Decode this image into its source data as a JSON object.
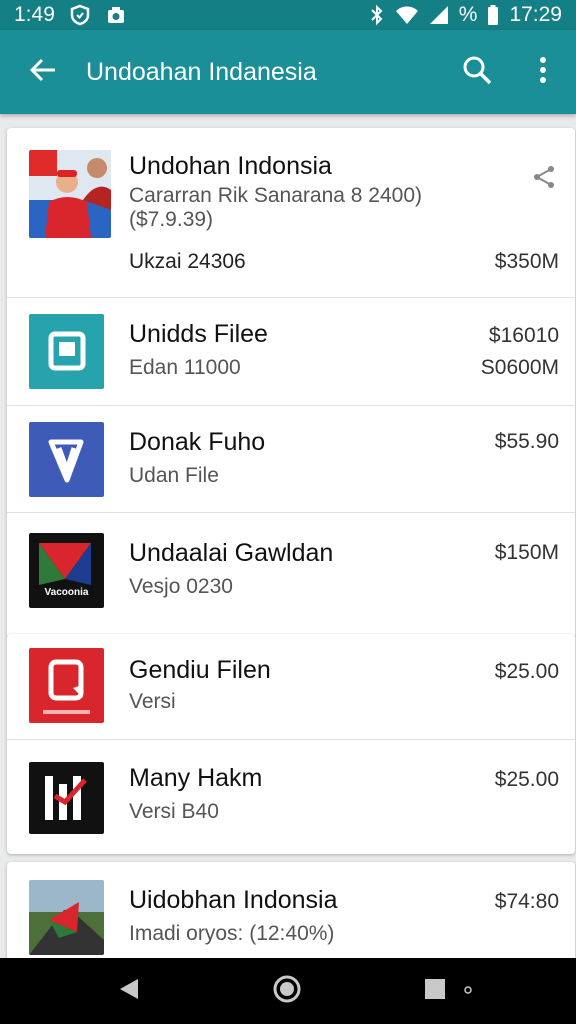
{
  "status_bar": {
    "time_left": "1:49",
    "battery_label": "%",
    "time_right": "17:29"
  },
  "app_bar": {
    "title": "Undoahan Indanesia",
    "back_icon": "arrow-back-icon",
    "search_icon": "search-icon",
    "more_icon": "more-vert-icon"
  },
  "items": [
    {
      "title": "Undohan Indonsia",
      "subtitle": "Cararran Rik Sanarana 8 2400)",
      "subtitle2": "($7.9.39)",
      "meta": "Ukzai 24306",
      "price": "$350M",
      "icon": "photo-thumbnail",
      "action_icon": "share-icon"
    },
    {
      "title": "Unidds Filee",
      "subtitle": "Edan 11000",
      "price": "$16010",
      "price2": "S0600M",
      "icon": "file-icon",
      "color": "#26a3ad"
    },
    {
      "title": "Donak Fuho",
      "subtitle": "Udan File",
      "price": "$55.90",
      "icon": "diamond-icon",
      "color": "#3f5bb8"
    },
    {
      "title": "Undaalai Gawldan",
      "subtitle": "Vesjo 0230",
      "price": "$150M",
      "icon": "play-triangle-icon",
      "icon_text": "Vacoonia",
      "color": "#111111"
    },
    {
      "title": "Gendiu Filen",
      "subtitle": "Versi",
      "price": "$25.00",
      "icon": "phone-chat-icon",
      "color": "#d8262c"
    },
    {
      "title": "Many Hakm",
      "subtitle": "Versi B40",
      "price": "$25.00",
      "icon": "bars-check-icon",
      "color": "#111111"
    },
    {
      "title": "Uidobhan Indonsia",
      "subtitle": "Imadi oryos: (12:40%)",
      "price": "$74:80",
      "icon": "landscape-thumbnail"
    }
  ],
  "nav_bar": {
    "back_icon": "nav-back-icon",
    "home_icon": "nav-home-icon",
    "recents_icon": "nav-recents-icon"
  }
}
